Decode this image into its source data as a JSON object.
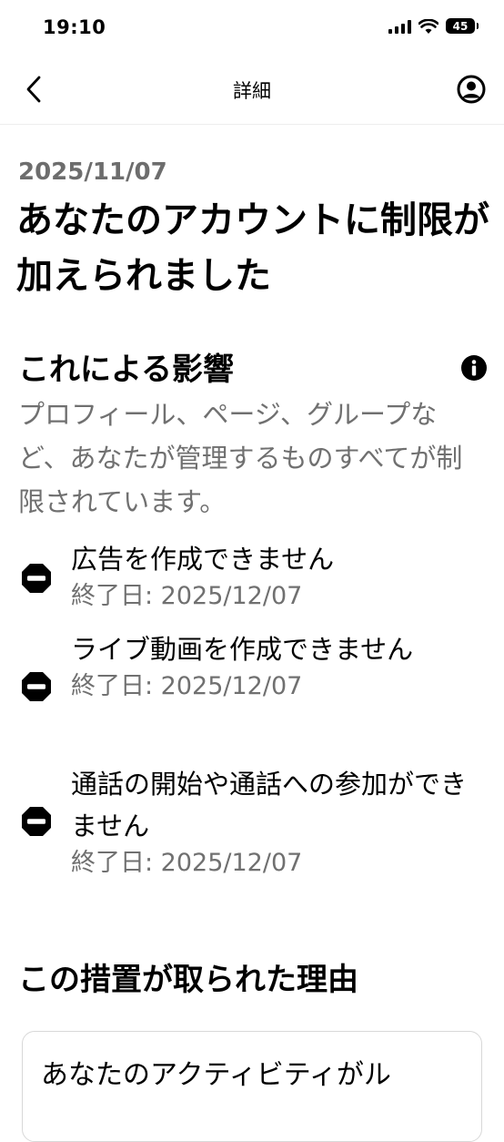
{
  "status_bar": {
    "time": "19:10",
    "battery": "45"
  },
  "nav": {
    "title": "詳細"
  },
  "date": "2025/11/07",
  "title": "あなたのアカウントに制限が加えられました",
  "impact": {
    "heading": "これによる影響",
    "description": "プロフィール、ページ、グループなど、あなたが管理するものすべてが制限されています。"
  },
  "restrictions": [
    {
      "title": "広告を作成できません",
      "end_date": "終了日: 2025/12/07"
    },
    {
      "title": "ライブ動画を作成できません",
      "end_date": "終了日: 2025/12/07"
    },
    {
      "title": "通話の開始や通話への参加ができません",
      "end_date": "終了日: 2025/12/07"
    }
  ],
  "reason": {
    "heading": "この措置が取られた理由",
    "card_text": "あなたのアクティビティがル"
  },
  "colors": {
    "secondary_text": "#707070",
    "date_text": "#6d6d6d",
    "divider": "#eeeeee"
  },
  "icons": [
    "back-chevron-icon",
    "profile-icon",
    "info-icon",
    "no-entry-icon"
  ]
}
